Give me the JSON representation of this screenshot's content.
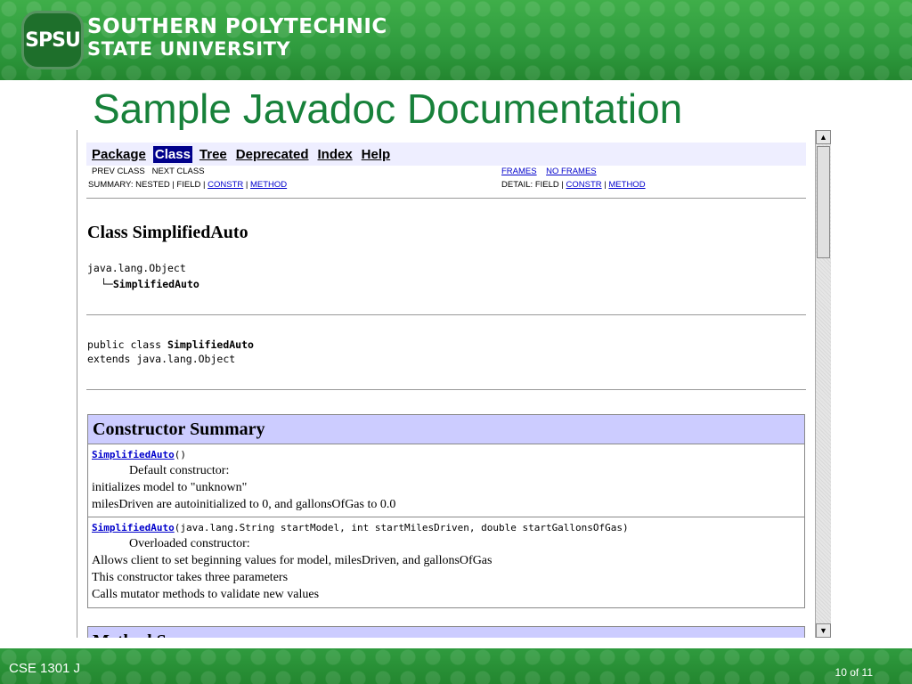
{
  "header": {
    "logo_text": "SPSU",
    "university_line1": "SOUTHERN POLYTECHNIC",
    "university_line2": "STATE UNIVERSITY"
  },
  "slide_title": "Sample Javadoc Documentation",
  "javadoc": {
    "nav": {
      "package": "Package",
      "class": "Class",
      "tree": "Tree",
      "deprecated": "Deprecated",
      "index": "Index",
      "help": "Help"
    },
    "subnav": {
      "prev_next": "PREV CLASS   NEXT CLASS",
      "summary_prefix": "SUMMARY: NESTED | FIELD | ",
      "constr": "CONSTR",
      "sep": " | ",
      "method": "METHOD",
      "frames": "FRAMES",
      "no_frames": "NO FRAMES",
      "detail_prefix": "DETAIL: FIELD | "
    },
    "class_title": "Class SimplifiedAuto",
    "hierarchy_root": "java.lang.Object",
    "hierarchy_child_glyph": "└─",
    "hierarchy_child": "SimplifiedAuto",
    "decl_prefix": "public class ",
    "decl_name": "SimplifiedAuto",
    "decl_extends": "extends java.lang.Object",
    "constructor_summary_title": "Constructor Summary",
    "constructors": [
      {
        "name": "SimplifiedAuto",
        "params": "()",
        "desc_head": "Default constructor:",
        "lines": [
          "initializes model to \"unknown\"",
          "milesDriven are autoinitialized to 0, and gallonsOfGas to 0.0"
        ]
      },
      {
        "name": "SimplifiedAuto",
        "params": "(java.lang.String startModel, int startMilesDriven, double startGallonsOfGas)",
        "desc_head": "Overloaded constructor:",
        "lines": [
          "Allows client to set beginning values for model, milesDriven, and gallonsOfGas",
          "This constructor takes three parameters",
          "Calls mutator methods to validate new values"
        ]
      }
    ],
    "method_summary_title": "Method S"
  },
  "scrollbar": {
    "up_glyph": "▲",
    "down_glyph": "▼"
  },
  "footer": {
    "course": "CSE 1301 J",
    "page": "10 of 11"
  }
}
